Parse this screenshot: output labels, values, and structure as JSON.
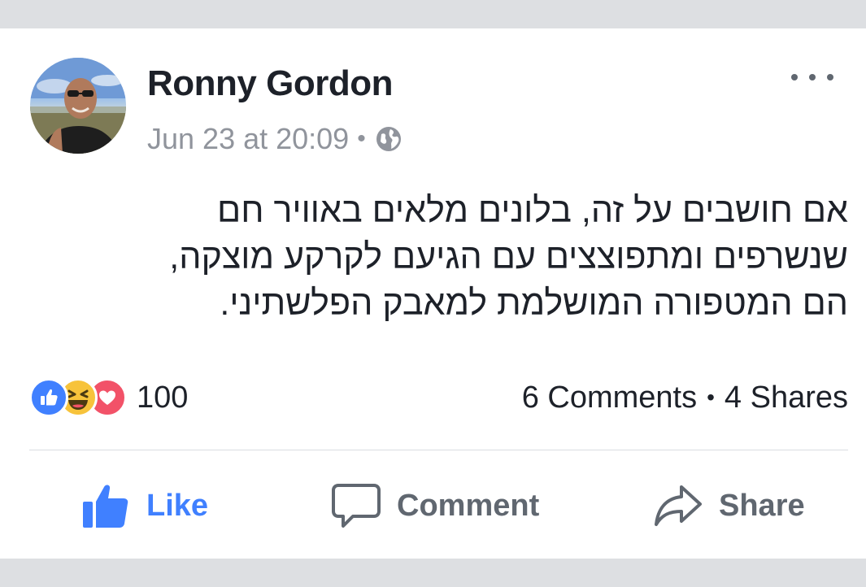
{
  "post": {
    "author": "Ronny Gordon",
    "timestamp": "Jun 23 at 20:09",
    "meta_separator": "•",
    "privacy_icon": "globe-icon",
    "more_icon": "more-options-icon",
    "text_lines": [
      "אם חושבים על זה, בלונים מלאים באוויר חם",
      "שנשרפים ומתפוצצים עם הגיעם לקרקע מוצקה,",
      "הם המטפורה המושלמת למאבק הפלשתיני."
    ]
  },
  "reactions": {
    "icons": [
      "like-reaction-icon",
      "haha-reaction-icon",
      "love-reaction-icon"
    ],
    "count": "100"
  },
  "stats": {
    "comments": "6 Comments",
    "separator": "•",
    "shares": "4 Shares"
  },
  "actions": {
    "like": "Like",
    "comment": "Comment",
    "share": "Share"
  },
  "colors": {
    "like_active": "#4080ff",
    "like_reaction": "#4080ff",
    "haha_reaction": "#f7c33b",
    "love_reaction": "#f25268",
    "secondary_text": "#90949c",
    "background": "#dddfe2"
  }
}
